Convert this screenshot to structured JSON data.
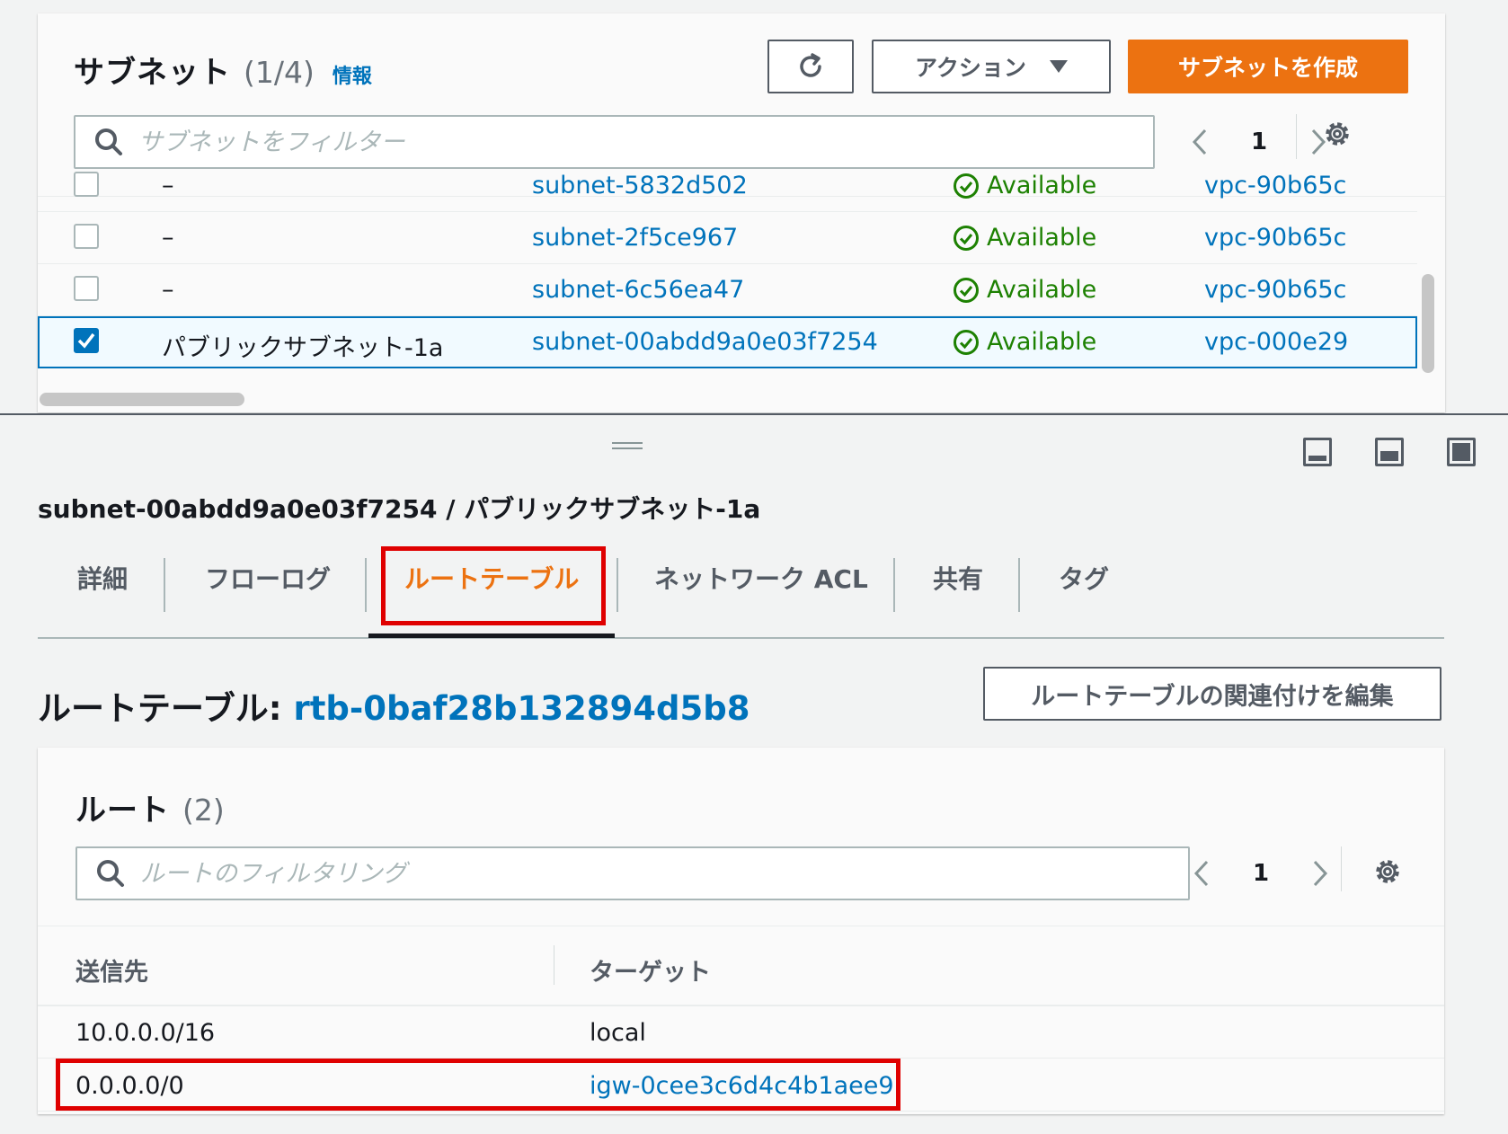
{
  "subnets": {
    "title": "サブネット",
    "count": "(1/4)",
    "info": "情報",
    "actions_label": "アクション",
    "create_label": "サブネットを作成",
    "search_placeholder": "サブネットをフィルター",
    "page": "1",
    "rows": [
      {
        "name": "–",
        "id": "subnet-5832d502",
        "status": "Available",
        "vpc": "vpc-90b65c",
        "checked": false
      },
      {
        "name": "–",
        "id": "subnet-2f5ce967",
        "status": "Available",
        "vpc": "vpc-90b65c",
        "checked": false
      },
      {
        "name": "–",
        "id": "subnet-6c56ea47",
        "status": "Available",
        "vpc": "vpc-90b65c",
        "checked": false
      },
      {
        "name": "パブリックサブネット-1a",
        "id": "subnet-00abdd9a0e03f7254",
        "status": "Available",
        "vpc": "vpc-000e29",
        "checked": true
      }
    ]
  },
  "detail": {
    "title": "subnet-00abdd9a0e03f7254 / パブリックサブネット-1a",
    "tabs": [
      "詳細",
      "フローログ",
      "ルートテーブル",
      "ネットワーク ACL",
      "共有",
      "タグ"
    ],
    "active_tab": "ルートテーブル",
    "route_table_label": "ルートテーブル:",
    "route_table_id": "rtb-0baf28b132894d5b8",
    "edit_assoc_label": "ルートテーブルの関連付けを編集"
  },
  "routes": {
    "title": "ルート",
    "count": "(2)",
    "search_placeholder": "ルートのフィルタリング",
    "page": "1",
    "columns": [
      "送信先",
      "ターゲット"
    ],
    "rows": [
      {
        "destination": "10.0.0.0/16",
        "target": "local",
        "target_is_link": false
      },
      {
        "destination": "0.0.0.0/0",
        "target": "igw-0cee3c6d4c4b1aee9",
        "target_is_link": true
      }
    ]
  },
  "colors": {
    "primary_button": "#ec7211",
    "link": "#0073bb",
    "available": "#1d8102",
    "highlight": "#df0000"
  }
}
